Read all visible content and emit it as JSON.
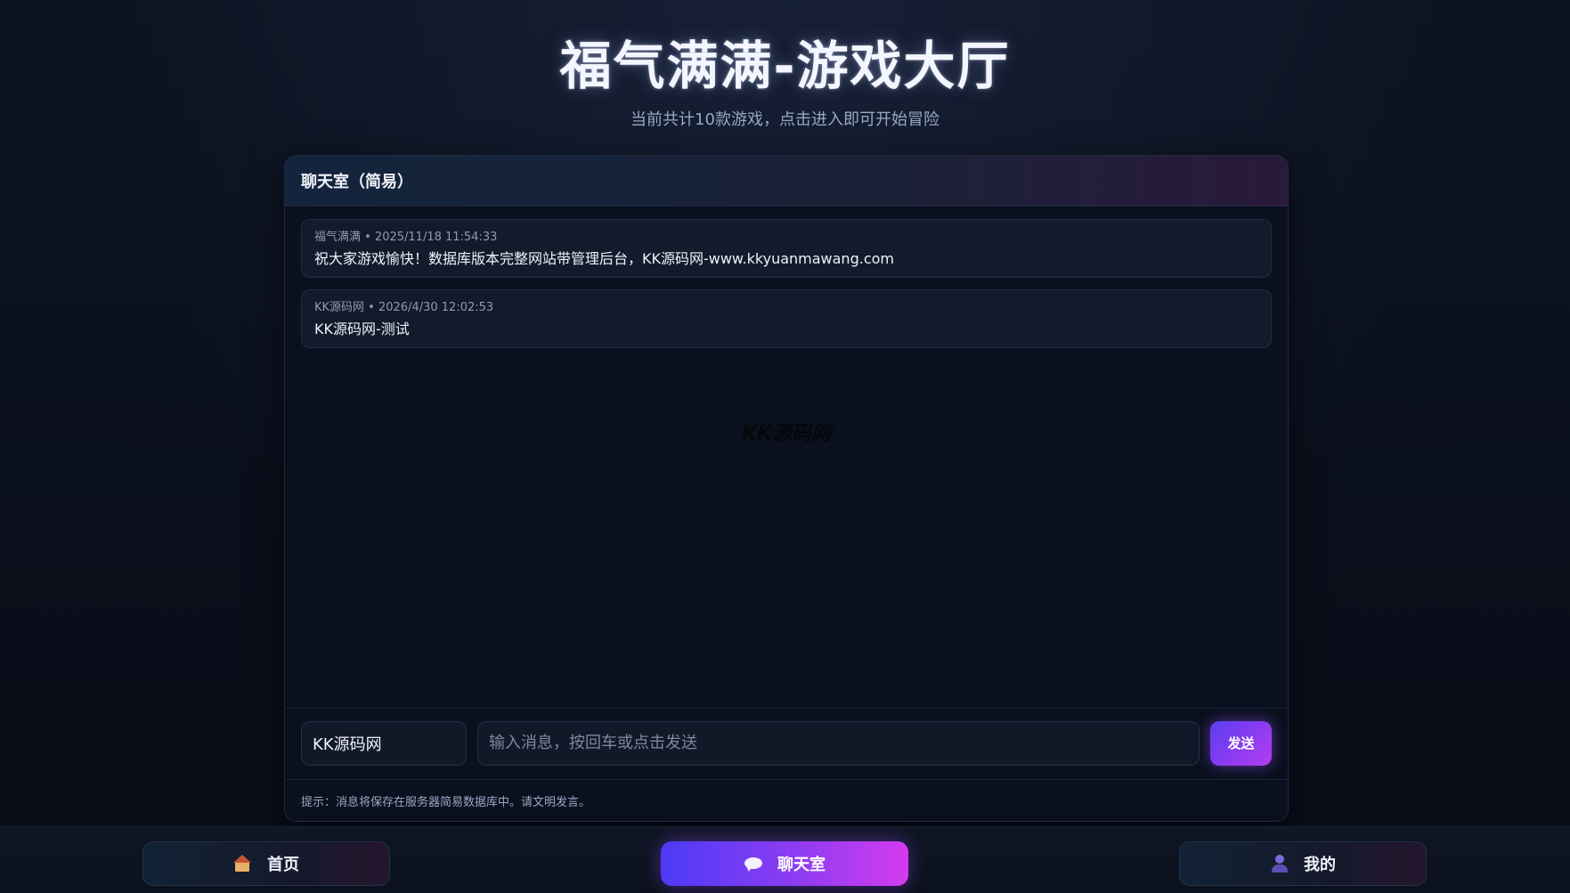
{
  "header": {
    "title": "福气满满-游戏大厅",
    "subtitle": "当前共计10款游戏，点击进入即可开始冒险"
  },
  "chat": {
    "title": "聊天室（简易）",
    "messages": [
      {
        "meta": "福气满满 • 2025/11/18 11:54:33",
        "text": "祝大家游戏愉快！数据库版本完整网站带管理后台，KK源码网-www.kkyuanmawang.com"
      },
      {
        "meta": "KK源码网 • 2026/4/30 12:02:53",
        "text": "KK源码网-测试"
      }
    ],
    "watermark": "KK源码网",
    "name_value": "KK源码网",
    "message_placeholder": "输入消息，按回车或点击发送",
    "send_label": "发送",
    "tip": "提示：消息将保存在服务器简易数据库中。请文明发言。"
  },
  "nav": {
    "home_label": "首页",
    "chat_label": "聊天室",
    "mine_label": "我的",
    "icons": {
      "home": "house-icon",
      "chat": "speech-bubble-icon",
      "mine": "user-icon"
    }
  },
  "colors": {
    "accent_start": "#4c3bf5",
    "accent_end": "#d53bef",
    "background": "#0a0f1a"
  }
}
